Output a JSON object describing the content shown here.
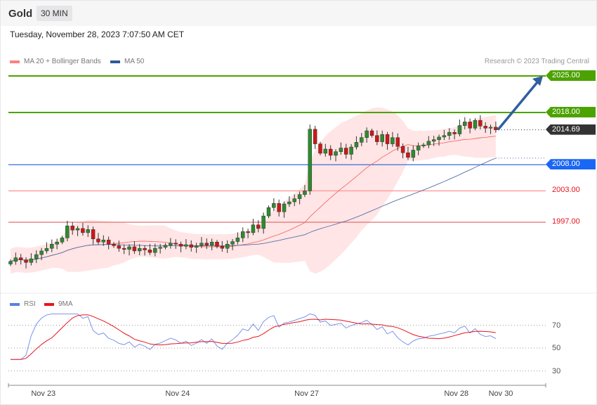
{
  "header": {
    "title": "Gold",
    "timeframe": "30 MIN",
    "datetime": "Tuesday, November 28, 2023 7:07:50 AM CET"
  },
  "legend": {
    "ma20": "MA 20 + Bollinger Bands",
    "ma50": "MA 50",
    "credit": "Research © 2023 Trading Central"
  },
  "rsi_legend": {
    "rsi": "RSI",
    "ma": "9MA"
  },
  "colors": {
    "resistance": "#4ca200",
    "support": "#1a66f5",
    "red": "#e8141c",
    "current": "#333333",
    "up": "#2e8b2e",
    "down": "#d11616",
    "ma20": "#f06060",
    "ma50": "#5a6fa8",
    "band": "#ffdede"
  },
  "levels": [
    {
      "label": "2025.00",
      "value": 2025,
      "kind": "resistance"
    },
    {
      "label": "2018.00",
      "value": 2018,
      "kind": "resistance"
    },
    {
      "label": "2014.69",
      "value": 2014.69,
      "kind": "current"
    },
    {
      "label": "2008.00",
      "value": 2008,
      "kind": "pivot"
    },
    {
      "label": "2003.00",
      "value": 2003,
      "kind": "support"
    },
    {
      "label": "1997.00",
      "value": 1997,
      "kind": "support"
    }
  ],
  "rsi_levels": [
    "70",
    "50",
    "30"
  ],
  "x_labels": [
    {
      "label": "Nov 23",
      "index": 5
    },
    {
      "label": "Nov 24",
      "index": 31
    },
    {
      "label": "Nov 27",
      "index": 56
    },
    {
      "label": "Nov 28",
      "index": 85
    },
    {
      "label": "Nov 30",
      "index": 95
    }
  ],
  "chart_data": {
    "type": "candlestick",
    "ylim": [
      1984,
      2028
    ],
    "closes": [
      1989.5,
      1990.2,
      1989.8,
      1989.3,
      1990.0,
      1990.8,
      1991.5,
      1992.0,
      1992.8,
      1993.2,
      1994.0,
      1996.3,
      1995.5,
      1995.8,
      1995.0,
      1995.6,
      1993.8,
      1993.2,
      1993.6,
      1992.8,
      1992.5,
      1992.0,
      1991.8,
      1992.3,
      1991.5,
      1992.0,
      1991.7,
      1991.2,
      1992.0,
      1992.2,
      1992.6,
      1993.0,
      1992.8,
      1992.4,
      1992.7,
      1992.2,
      1992.5,
      1993.0,
      1992.6,
      1993.2,
      1992.4,
      1992.0,
      1992.8,
      1993.3,
      1994.0,
      1995.2,
      1995.0,
      1996.5,
      1995.8,
      1998.2,
      1999.8,
      2000.6,
      1999.0,
      2000.5,
      2000.9,
      2001.5,
      2002.3,
      2003.0,
      2014.8,
      2012.0,
      2010.2,
      2011.0,
      2009.8,
      2010.5,
      2011.2,
      2010.0,
      2011.4,
      2012.3,
      2013.2,
      2014.5,
      2013.6,
      2012.4,
      2013.8,
      2012.0,
      2013.2,
      2011.5,
      2010.3,
      2009.4,
      2010.8,
      2011.6,
      2011.8,
      2012.5,
      2012.8,
      2013.3,
      2013.6,
      2014.2,
      2013.9,
      2015.5,
      2016.2,
      2015.0,
      2016.5,
      2015.4,
      2015.0,
      2015.2,
      2014.69
    ],
    "target": 2025
  }
}
